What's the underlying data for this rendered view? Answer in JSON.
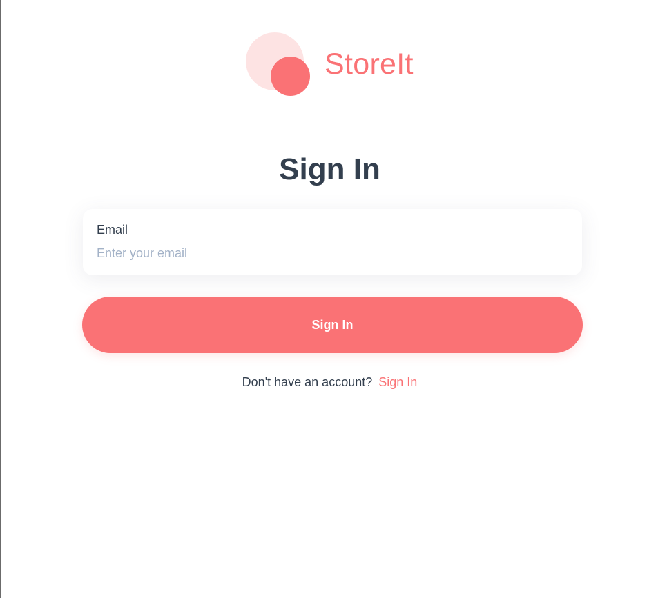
{
  "brand": {
    "name": "StoreIt",
    "primary_color": "#fa7275",
    "light_color": "#fde3e3"
  },
  "form": {
    "title": "Sign In",
    "email": {
      "label": "Email",
      "placeholder": "Enter your email",
      "value": ""
    },
    "submit_label": "Sign In"
  },
  "footer": {
    "prompt": "Don't have an account?",
    "link_label": "Sign In"
  },
  "colors": {
    "text_dark": "#333f4e",
    "placeholder": "#a3b2c7",
    "background": "#ffffff"
  }
}
